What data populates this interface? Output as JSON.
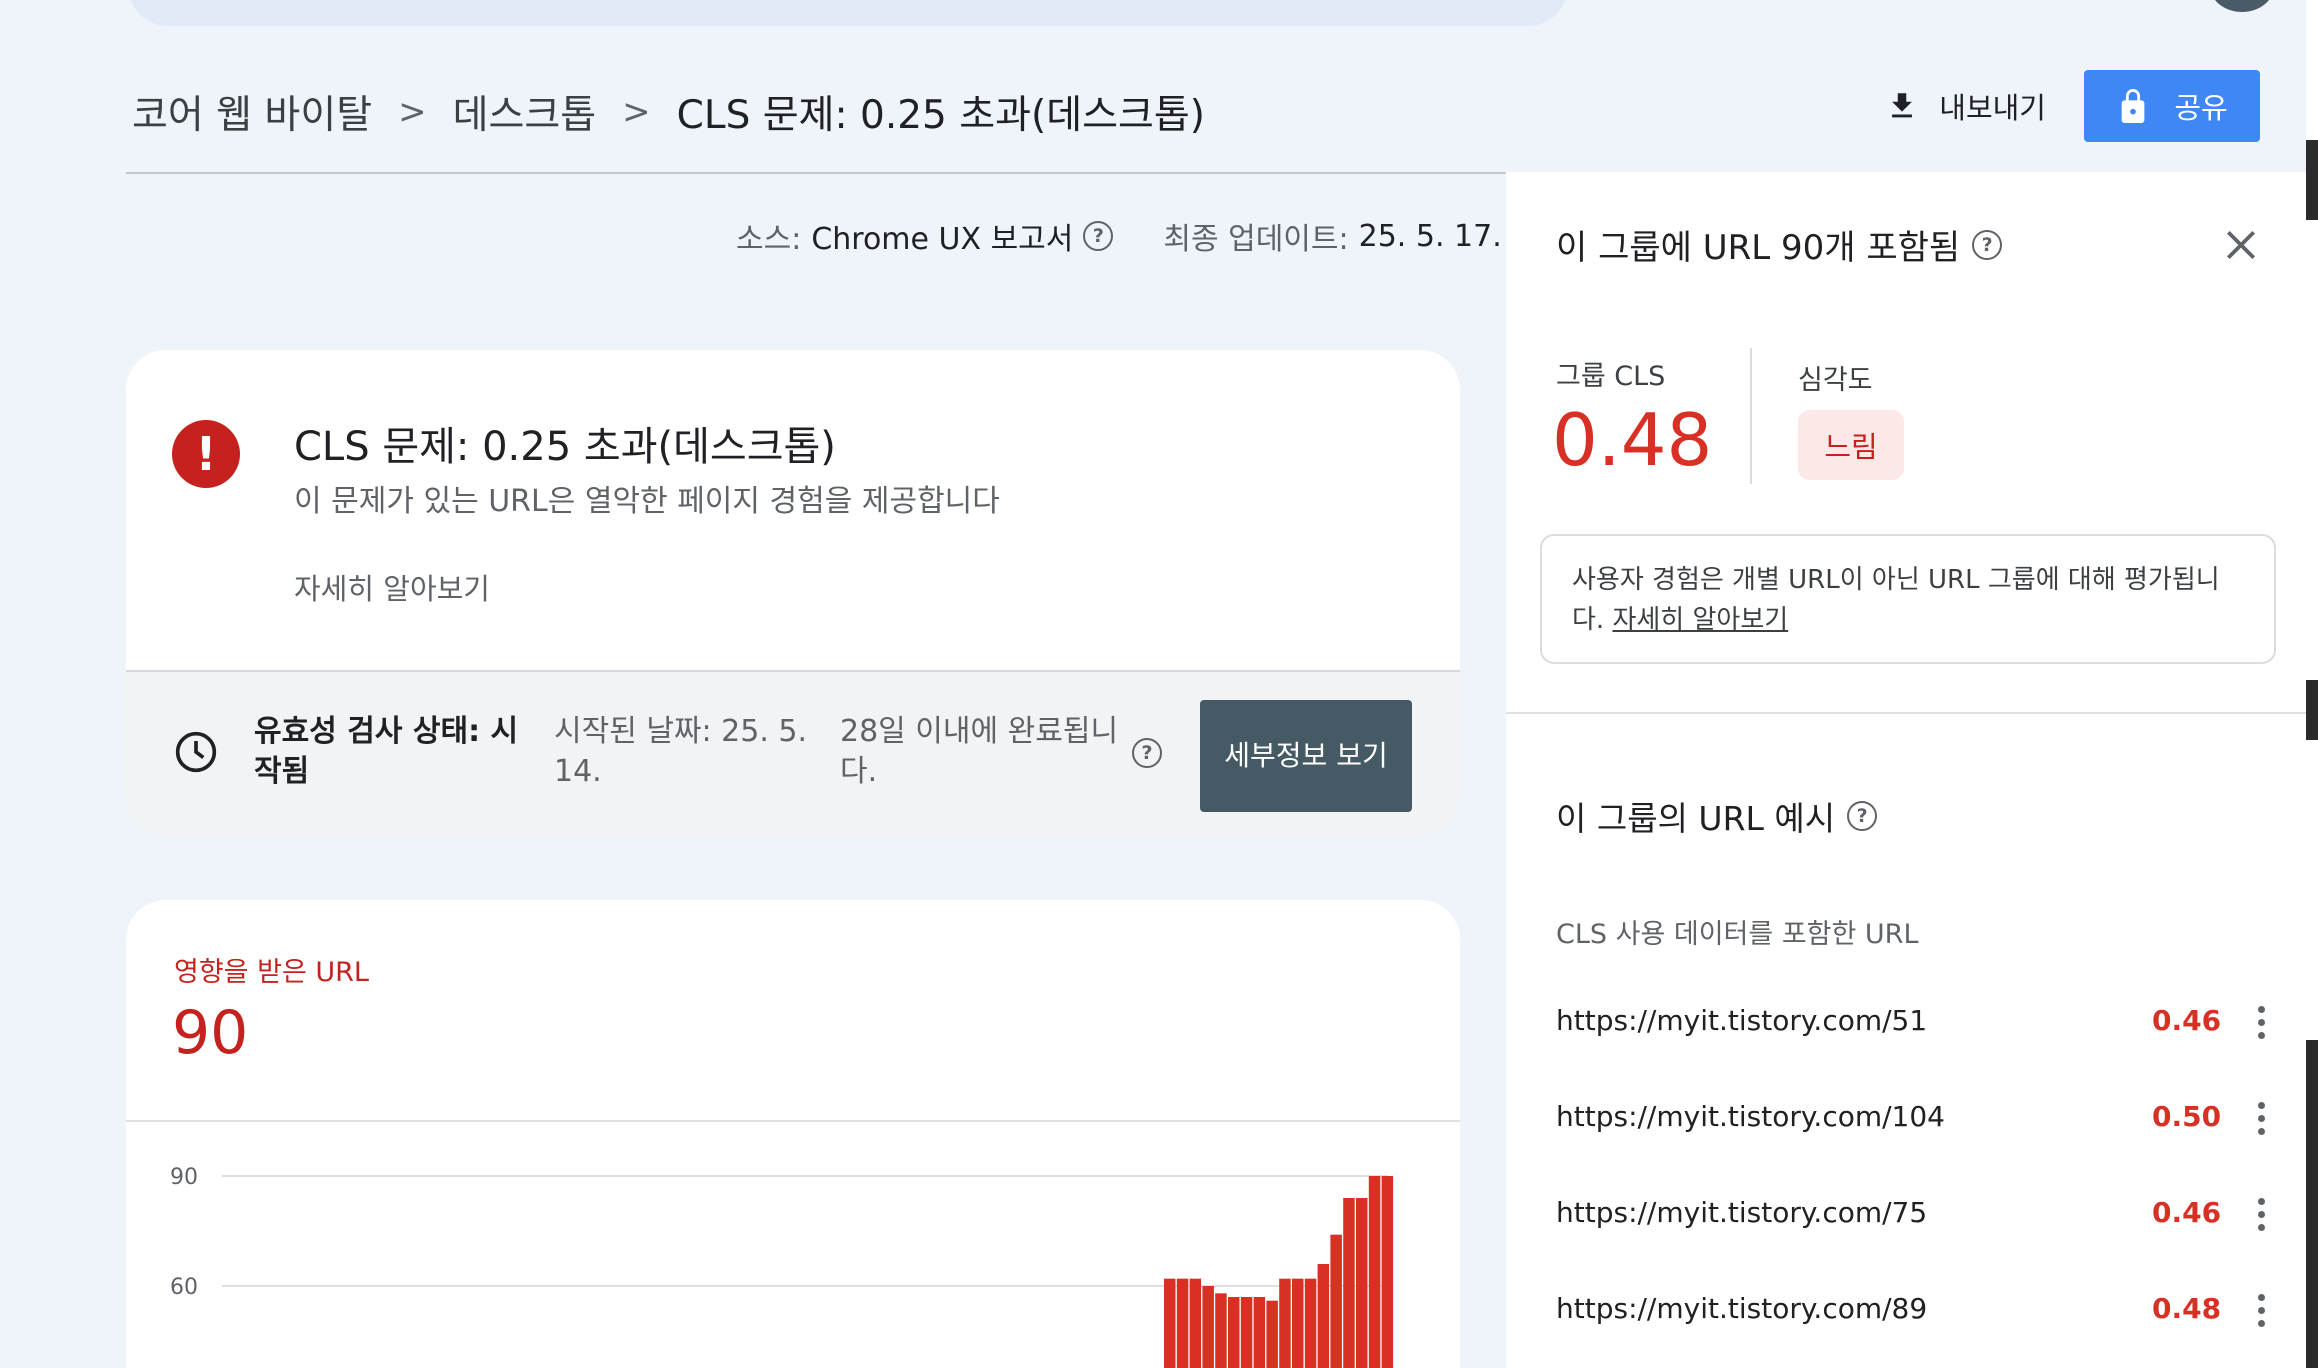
{
  "breadcrumb": {
    "items": [
      "코어 웹 바이탈",
      "데스크톱",
      "CLS 문제: 0.25 초과(데스크톱)"
    ],
    "separator": ">"
  },
  "header": {
    "export_label": "내보내기",
    "share_label": "공유"
  },
  "meta": {
    "source_label": "소스:",
    "source_value": "Chrome UX 보고서",
    "updated_label": "최종 업데이트:",
    "updated_value": "25. 5. 17."
  },
  "issue": {
    "title": "CLS 문제: 0.25 초과(데스크톱)",
    "subtitle": "이 문제가 있는 URL은 열악한 페이지 경험을 제공합니다",
    "learn_more": "자세히 알아보기",
    "validation_status": "유효성 검사 상태: 시작됨",
    "started": "시작된 날짜: 25. 5. 14.",
    "complete": "28일 이내에 완료됩니다.",
    "details_button": "세부정보 보기"
  },
  "affected": {
    "label": "영향을 받은 URL",
    "count": "90"
  },
  "chart_data": {
    "type": "bar",
    "y_ticks": [
      "90",
      "60"
    ],
    "ylim": [
      0,
      90
    ],
    "values": [
      62,
      62,
      62,
      60,
      58,
      57,
      57,
      57,
      56,
      62,
      62,
      62,
      66,
      74,
      84,
      84,
      90,
      90
    ],
    "color": "#d93025"
  },
  "panel": {
    "title": "이 그룹에 URL 90개 포함됨",
    "group_cls_label": "그룹 CLS",
    "group_cls_value": "0.48",
    "severity_label": "심각도",
    "severity_value": "느림",
    "info_text": "사용자 경험은 개별 URL이 아닌 URL 그룹에 대해 평가됩니다.",
    "info_link": "자세히 알아보기",
    "examples_title": "이 그룹의 URL 예시",
    "examples_subtitle": "CLS 사용 데이터를 포함한 URL",
    "urls": [
      {
        "url": "https://myit.tistory.com/51",
        "value": "0.46"
      },
      {
        "url": "https://myit.tistory.com/104",
        "value": "0.50"
      },
      {
        "url": "https://myit.tistory.com/75",
        "value": "0.46"
      },
      {
        "url": "https://myit.tistory.com/89",
        "value": "0.48"
      }
    ]
  },
  "colors": {
    "accent_blue": "#3f87f5",
    "error_red": "#d93025",
    "button_dark": "#455a64"
  }
}
